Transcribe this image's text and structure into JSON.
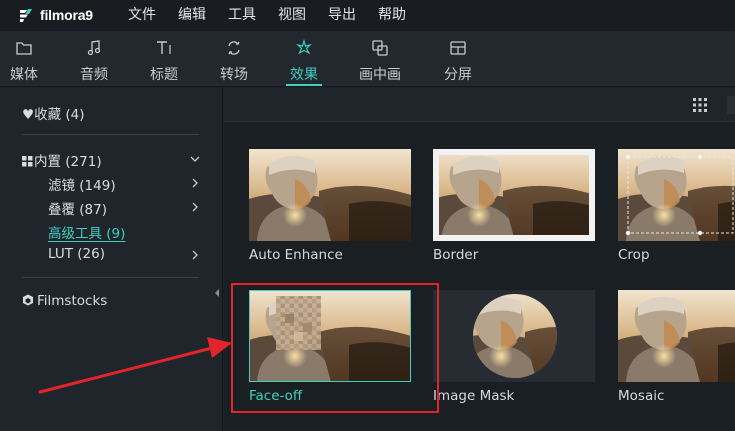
{
  "app": {
    "logo_text": "filmora9"
  },
  "menu": [
    "文件",
    "编辑",
    "工具",
    "视图",
    "导出",
    "帮助"
  ],
  "tabs": [
    {
      "label": "媒体",
      "icon": "folder-icon"
    },
    {
      "label": "音频",
      "icon": "music-note-icon"
    },
    {
      "label": "标题",
      "icon": "text-title-icon"
    },
    {
      "label": "转场",
      "icon": "transition-icon"
    },
    {
      "label": "效果",
      "icon": "effects-icon",
      "active": true
    },
    {
      "label": "画中画",
      "icon": "picture-in-picture-icon"
    },
    {
      "label": "分屏",
      "icon": "split-screen-icon"
    }
  ],
  "sidebar": {
    "favorites": "收藏 (4)",
    "builtin": "内置 (271)",
    "filters": "滤镜 (149)",
    "overlays": "叠覆 (87)",
    "advanced_tools": "高级工具 (9)",
    "lut": "LUT (26)",
    "filmstocks": "Filmstocks"
  },
  "effects": [
    {
      "label": "Auto Enhance"
    },
    {
      "label": "Border"
    },
    {
      "label": "Crop"
    },
    {
      "label": "Face-off",
      "selected": true
    },
    {
      "label": "Image Mask"
    },
    {
      "label": "Mosaic"
    }
  ],
  "colors": {
    "accent": "#3fd0c0",
    "annotation": "#e2252b",
    "background": "#1c2126"
  }
}
